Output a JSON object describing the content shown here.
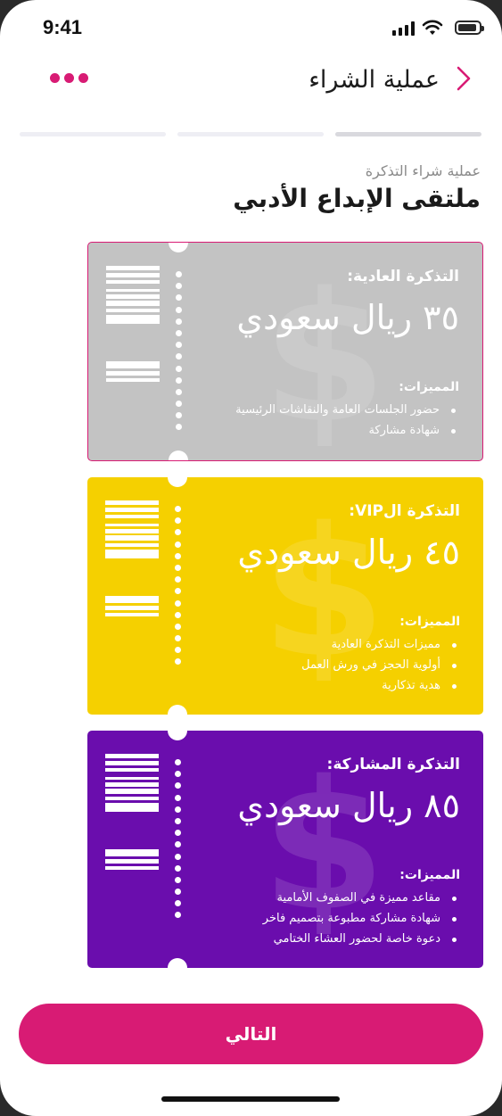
{
  "status_bar": {
    "time": "9:41"
  },
  "header": {
    "title": "عملية الشراء"
  },
  "progress": {
    "steps": 3,
    "current": 1
  },
  "page": {
    "subtitle": "عملية شراء التذكرة",
    "event_title": "ملتقى الإبداع الأدبي"
  },
  "tickets": [
    {
      "id": "regular",
      "title": "التذكرة العادية:",
      "price": "٣٥ ريال سعودي",
      "features_label": "المميزات:",
      "features": [
        "حضور الجلسات العامة والنقاشات الرئيسية",
        "شهادة مشاركة"
      ],
      "color": "#c3c3c3",
      "selected": true
    },
    {
      "id": "vip",
      "title": "التذكرة الVIP:",
      "price": "٤٥ ريال سعودي",
      "features_label": "المميزات:",
      "features": [
        "مميزات التذكرة العادية",
        "أولوية الحجز في ورش العمل",
        "هدية تذكارية"
      ],
      "color": "#f5d000",
      "selected": false
    },
    {
      "id": "participant",
      "title": "التذكرة المشاركة:",
      "price": "٨٥ ريال سعودي",
      "features_label": "المميزات:",
      "features": [
        "مقاعد مميزة في الصفوف الأمامية",
        "شهادة مشاركة مطبوعة بتصميم فاخر",
        "دعوة خاصة لحضور العشاء الختامي"
      ],
      "color": "#6a0dad",
      "selected": false
    }
  ],
  "footer": {
    "next_label": "التالي"
  },
  "colors": {
    "accent": "#d81b74",
    "selected_border": "#d81b74"
  }
}
